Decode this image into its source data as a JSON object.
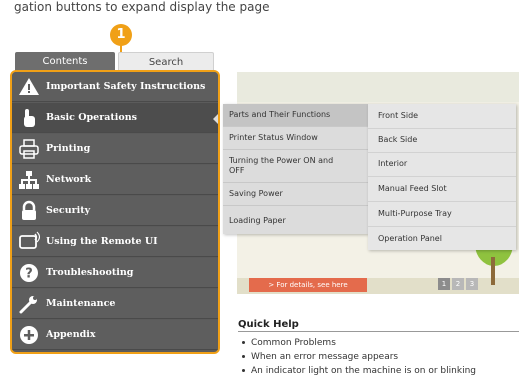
{
  "header_text": "gation buttons to expand display the page",
  "callout_number": "1",
  "tabs": {
    "contents": "Contents",
    "search": "Search"
  },
  "sidebar": {
    "items": [
      {
        "label": "Important Safety Instructions",
        "icon": "warning-icon"
      },
      {
        "label": "Basic Operations",
        "icon": "hand-icon"
      },
      {
        "label": "Printing",
        "icon": "printer-icon"
      },
      {
        "label": "Network",
        "icon": "network-icon"
      },
      {
        "label": "Security",
        "icon": "lock-icon"
      },
      {
        "label": "Using the Remote UI",
        "icon": "remote-ui-icon"
      },
      {
        "label": "Troubleshooting",
        "icon": "question-icon"
      },
      {
        "label": "Maintenance",
        "icon": "wrench-icon"
      },
      {
        "label": "Appendix",
        "icon": "plus-icon"
      }
    ]
  },
  "flyout1": {
    "items": [
      "Parts and Their Functions",
      "Printer Status Window",
      "Turning the Power ON and",
      "OFF",
      "Saving Power",
      "Loading Paper"
    ]
  },
  "flyout2": {
    "items": [
      "Front Side",
      "Back Side",
      "Interior",
      "Manual Feed Slot",
      "Multi-Purpose Tray",
      "Operation Panel"
    ]
  },
  "banner": {
    "details_button": "> For details, see here",
    "pages": [
      "1",
      "2",
      "3"
    ]
  },
  "quick_help": {
    "title": "Quick Help",
    "items": [
      "Common Problems",
      "When an error message appears",
      "An indicator light on the machine is on or blinking"
    ]
  },
  "colors": {
    "accent": "#f0a017",
    "sidebar_bg": "#5b5b5b",
    "details_button": "#e46b4c"
  }
}
